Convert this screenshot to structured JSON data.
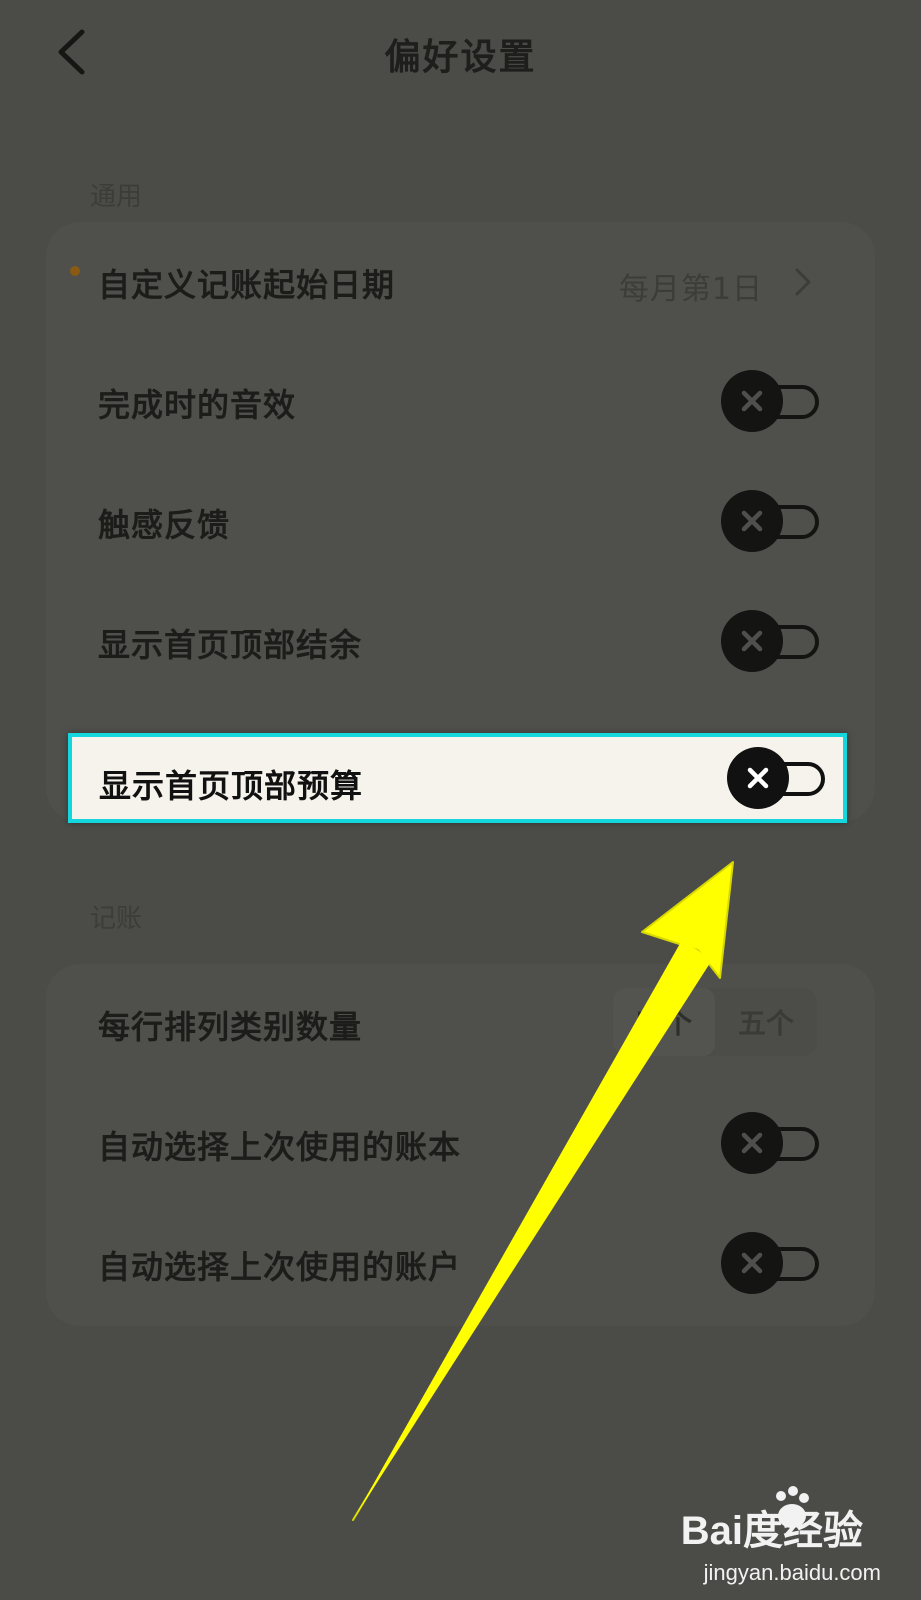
{
  "header": {
    "title": "偏好设置",
    "back_icon": "chevron-left-icon"
  },
  "sections": {
    "general": {
      "label": "通用",
      "start_date": {
        "label": "自定义记账起始日期",
        "value": "每月第1日"
      },
      "sound": {
        "label": "完成时的音效",
        "state": "off"
      },
      "haptic": {
        "label": "触感反馈",
        "state": "off"
      },
      "balance": {
        "label": "显示首页顶部结余",
        "state": "off"
      },
      "budget": {
        "label": "显示首页顶部预算",
        "state": "off"
      }
    },
    "bookkeeping": {
      "label": "记账",
      "categories_per_row": {
        "label": "每行排列类别数量",
        "options": [
          "四个",
          "五个"
        ],
        "selected": "四个"
      },
      "auto_book": {
        "label": "自动选择上次使用的账本",
        "state": "off"
      },
      "auto_account": {
        "label": "自动选择上次使用的账户",
        "state": "off"
      }
    }
  },
  "colors": {
    "highlight_border": "#13d7dd",
    "arrow": "#ffff00",
    "dimmed_bg": "#4b4b48"
  },
  "watermark": {
    "logo": "Bai度经验",
    "url": "jingyan.baidu.com"
  }
}
